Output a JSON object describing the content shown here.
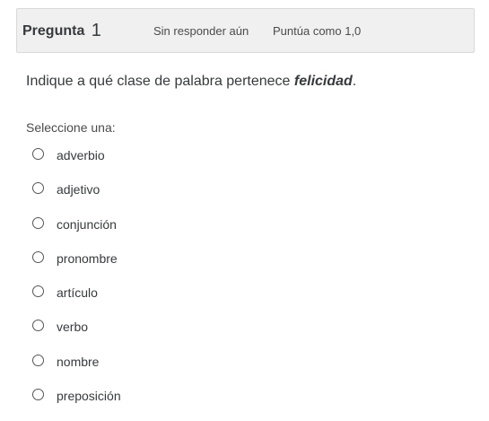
{
  "question": {
    "label": "Pregunta",
    "number": "1",
    "state": "Sin responder aún",
    "grade": "Puntúa como 1,0",
    "text_before": "Indique a qué clase de palabra pertenece ",
    "text_emphasis": "felicidad",
    "text_after": ".",
    "prompt": "Seleccione una:"
  },
  "answers": [
    {
      "label": "adverbio"
    },
    {
      "label": "adjetivo"
    },
    {
      "label": "conjunción"
    },
    {
      "label": "pronombre"
    },
    {
      "label": "artículo"
    },
    {
      "label": "verbo"
    },
    {
      "label": "nombre"
    },
    {
      "label": "preposición"
    }
  ]
}
